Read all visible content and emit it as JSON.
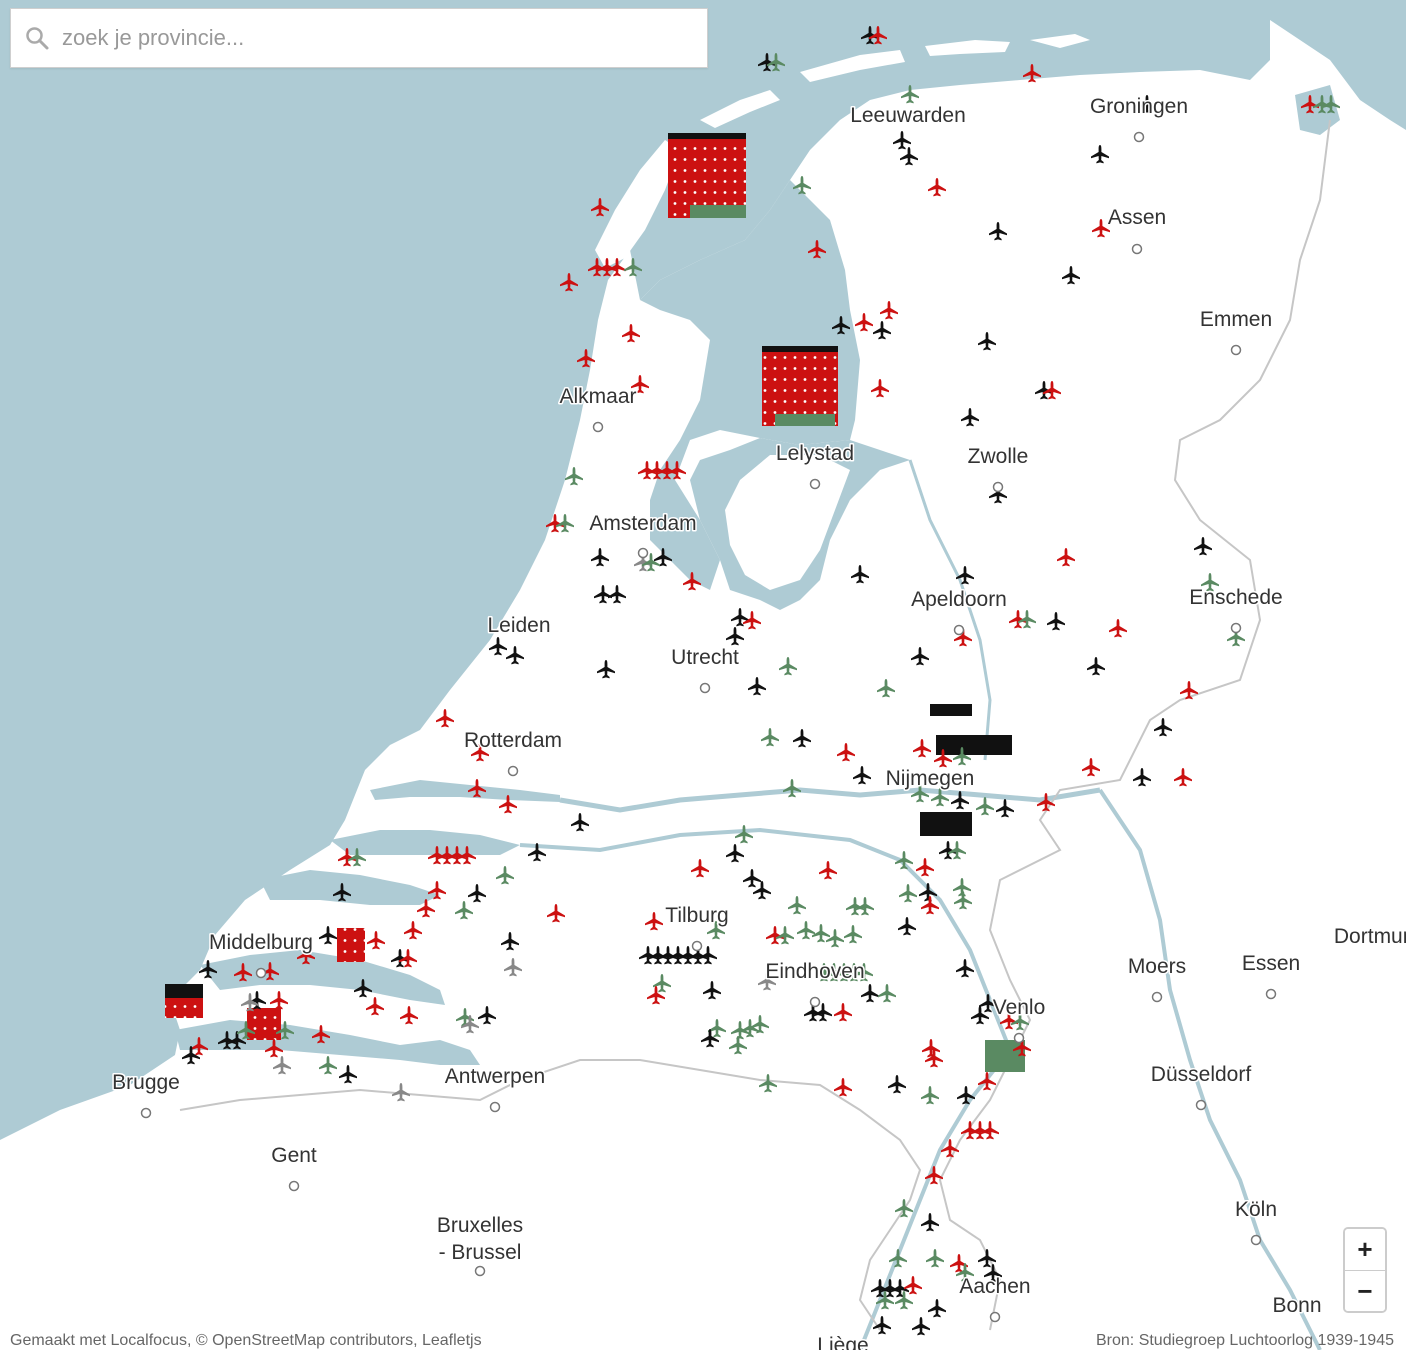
{
  "search": {
    "placeholder": "zoek je provincie..."
  },
  "zoom": {
    "in_label": "+",
    "out_label": "−"
  },
  "footer": {
    "attribution": "Gemaakt met Localfocus, © OpenStreetMap contributors, Leafletjs",
    "source": "Bron: Studiegroep Luchtoorlog 1939-1945"
  },
  "colors": {
    "water": "#aecbd4",
    "land": "#ffffff",
    "border": "#c6c6c6",
    "plane_red": "#cc1111",
    "plane_black": "#111111",
    "plane_green": "#5a8a62",
    "plane_gray": "#888888"
  },
  "icons": {
    "plane": "airplane-icon",
    "search": "search-icon"
  },
  "cities": [
    "Leeuwarden",
    "Groningen",
    "Assen",
    "Emmen",
    "Alkmaar",
    "Lelystad",
    "Zwolle",
    "Amsterdam",
    "Apeldoorn",
    "Enschede",
    "Leiden",
    "Utrecht",
    "Rotterdam",
    "Nijmegen",
    "Middelburg",
    "Tilburg",
    "Eindhoven",
    "Moers",
    "Essen",
    "Dortmund",
    "Venlo",
    "Brugge",
    "Antwerpen",
    "Düsseldorf",
    "Gent",
    "Bruxelles",
    "- Brussel",
    "Köln",
    "Aachen",
    "Bonn",
    "Liège"
  ],
  "legend_note": "plane markers colored red, black, green and gray mark crash sites"
}
